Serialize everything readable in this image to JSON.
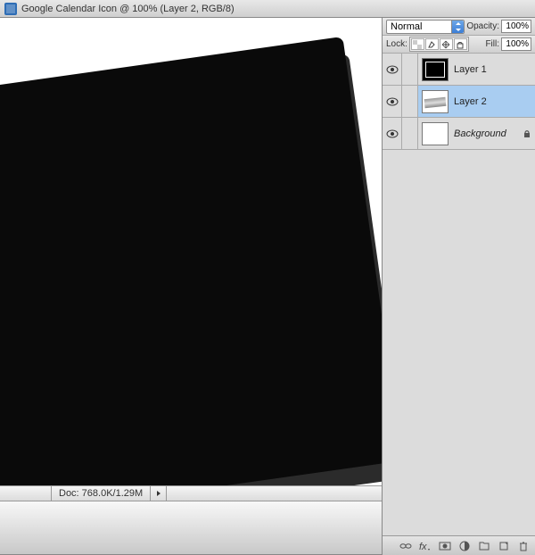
{
  "titlebar": {
    "title": "Google Calendar Icon @ 100% (Layer 2, RGB/8)"
  },
  "status": {
    "doc": "Doc: 768.0K/1.29M"
  },
  "panel": {
    "blend_mode": "Normal",
    "opacity_label": "Opacity:",
    "opacity_value": "100%",
    "lock_label": "Lock:",
    "fill_label": "Fill:",
    "fill_value": "100%"
  },
  "layers": [
    {
      "name": "Layer 1",
      "visible": true,
      "locked": false,
      "selected": false,
      "italic": false
    },
    {
      "name": "Layer 2",
      "visible": true,
      "locked": false,
      "selected": true,
      "italic": false
    },
    {
      "name": "Background",
      "visible": true,
      "locked": true,
      "selected": false,
      "italic": true
    }
  ]
}
